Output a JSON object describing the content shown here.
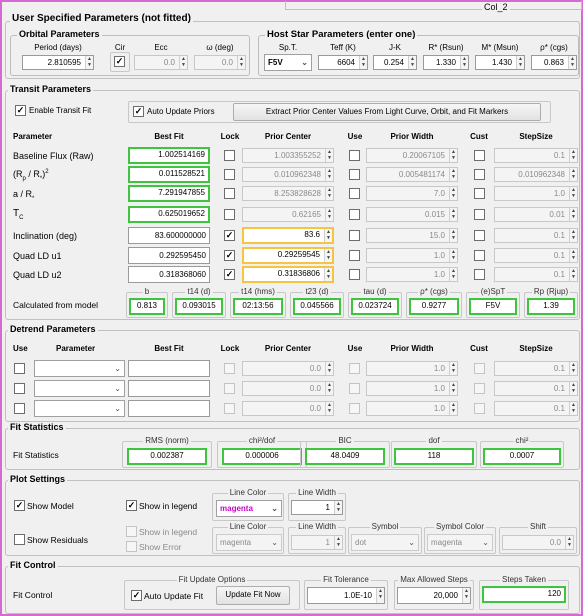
{
  "window": {
    "title": "Col_2"
  },
  "user_params": {
    "title": "User Specified Parameters (not fitted)",
    "orbital": {
      "title": "Orbital Parameters",
      "period_label": "Period (days)",
      "period": "2.810595",
      "cir_label": "Cir",
      "ecc_label": "Ecc",
      "ecc": "0.0",
      "omega_label": "ω (deg)",
      "omega": "0.0"
    },
    "host": {
      "title": "Host Star Parameters (enter one)",
      "sptype_label": "Sp.T.",
      "sptype": "F5V",
      "teff_label": "Teff (K)",
      "teff": "6604",
      "jk_label": "J-K",
      "jk": "0.254",
      "rstar_label": "R* (Rsun)",
      "rstar": "1.330",
      "mstar_label": "M* (Msun)",
      "mstar": "1.430",
      "rho_label": "ρ* (cgs)",
      "rho": "0.863"
    }
  },
  "transit": {
    "title": "Transit Parameters",
    "enable_label": "Enable Transit Fit",
    "auto_priors_label": "Auto Update Priors",
    "extract_button": "Extract Prior Center Values From Light Curve, Orbit, and Fit Markers",
    "headers": {
      "param": "Parameter",
      "best": "Best Fit",
      "lock": "Lock",
      "prior_center": "Prior Center",
      "use": "Use",
      "prior_width": "Prior Width",
      "cust": "Cust",
      "step": "StepSize"
    },
    "rows": [
      {
        "name": "Baseline Flux (Raw)",
        "best": "1.002514169",
        "prior_center": "1.003355252",
        "prior_width": "0.20067105",
        "step": "0.1"
      },
      {
        "name": "",
        "best": "0.011528521",
        "prior_center": "0.010962348",
        "prior_width": "0.005481174",
        "step": "0.010962348"
      },
      {
        "name": "",
        "best": "7.291947855",
        "prior_center": "8.253828628",
        "prior_width": "7.0",
        "step": "1.0"
      },
      {
        "name": "",
        "best": "0.625019652",
        "prior_center": "0.62165",
        "prior_width": "0.015",
        "step": "0.01"
      },
      {
        "name": "Inclination (deg)",
        "best": "83.600000000",
        "prior_center": "83.6",
        "prior_width": "15.0",
        "step": "0.1"
      },
      {
        "name": "Quad LD u1",
        "best": "0.292595450",
        "prior_center": "0.29259545",
        "prior_width": "1.0",
        "step": "0.1"
      },
      {
        "name": "Quad LD u2",
        "best": "0.318368060",
        "prior_center": "0.31836806",
        "prior_width": "1.0",
        "step": "0.1"
      }
    ],
    "calc_label": "Calculated from model",
    "calc": [
      {
        "label": "b",
        "value": "0.813"
      },
      {
        "label": "t14 (d)",
        "value": "0.093015"
      },
      {
        "label": "t14 (hms)",
        "value": "02:13:56"
      },
      {
        "label": "t23 (d)",
        "value": "0.045566"
      },
      {
        "label": "tau (d)",
        "value": "0.023724"
      },
      {
        "label": "ρ* (cgs)",
        "value": "0.9277"
      },
      {
        "label": "(e)SpT",
        "value": "F5V"
      },
      {
        "label": "Rp (Rjup)",
        "value": "1.39"
      }
    ]
  },
  "detrend": {
    "title": "Detrend Parameters",
    "headers": {
      "use": "Use",
      "param": "Parameter",
      "best": "Best Fit",
      "lock": "Lock",
      "prior_center": "Prior Center",
      "use2": "Use",
      "prior_width": "Prior Width",
      "cust": "Cust",
      "step": "StepSize"
    },
    "rows": [
      {
        "prior_center": "0.0",
        "prior_width": "1.0",
        "step": "0.1"
      },
      {
        "prior_center": "0.0",
        "prior_width": "1.0",
        "step": "0.1"
      },
      {
        "prior_center": "0.0",
        "prior_width": "1.0",
        "step": "0.1"
      }
    ]
  },
  "fit_stats": {
    "title": "Fit Statistics",
    "label": "Fit Statistics",
    "items": [
      {
        "label": "RMS (norm)",
        "value": "0.002387"
      },
      {
        "label": "chi²/dof",
        "value": "0.000006"
      },
      {
        "label": "BIC",
        "value": "48.0409"
      },
      {
        "label": "dof",
        "value": "118"
      },
      {
        "label": "chi²",
        "value": "0.0007"
      }
    ]
  },
  "plot": {
    "title": "Plot Settings",
    "show_model": "Show Model",
    "show_in_legend": "Show in legend",
    "line_color_label": "Line Color",
    "model_color": "magenta",
    "line_width_label": "Line Width",
    "model_width": "1",
    "show_residuals": "Show Residuals",
    "show_in_legend2": "Show in legend",
    "show_error": "Show Error",
    "res_color": "magenta",
    "res_width": "1",
    "symbol_label": "Symbol",
    "symbol": "dot",
    "symbol_color_label": "Symbol Color",
    "symbol_color": "magenta",
    "shift_label": "Shift",
    "shift": "0.0"
  },
  "fit_control": {
    "title": "Fit Control",
    "label": "Fit Control",
    "options_label": "Fit Update Options",
    "auto_update": "Auto Update Fit",
    "update_now": "Update Fit Now",
    "tolerance_label": "Fit Tolerance",
    "tolerance": "1.0E-10",
    "max_steps_label": "Max Allowed Steps",
    "max_steps": "20,000",
    "steps_taken_label": "Steps Taken",
    "steps_taken": "120"
  },
  "colors": {
    "accent_green": "#3fc43f",
    "accent_yellow": "#f5c542",
    "magenta": "#cc00cc",
    "border": "#d36bd3"
  }
}
